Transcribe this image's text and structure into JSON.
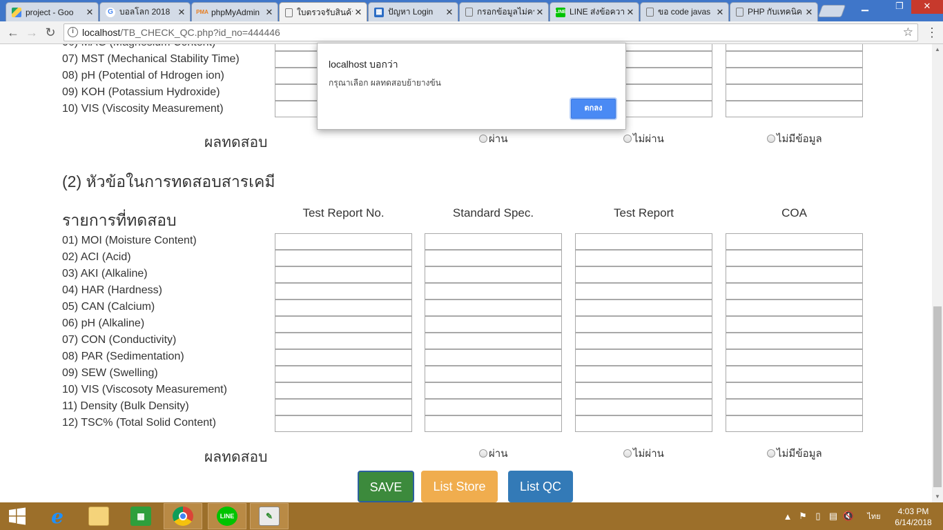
{
  "tabs": [
    {
      "title": "project - Goo",
      "icon": "google-drive-icon"
    },
    {
      "title": "บอลโลก 2018",
      "icon": "google-icon"
    },
    {
      "title": "phpMyAdmin",
      "icon": "phpmyadmin-icon"
    },
    {
      "title": "ใบตรวจรับสินค้า",
      "icon": "document-icon"
    },
    {
      "title": "ปัญหา Login",
      "icon": "site-icon"
    },
    {
      "title": "กรอกข้อมูลไม่คร",
      "icon": "document-icon"
    },
    {
      "title": "LINE ส่งข้อความ",
      "icon": "line-icon"
    },
    {
      "title": "ขอ code javas",
      "icon": "document-icon"
    },
    {
      "title": "PHP กับเทคนิค",
      "icon": "document-icon"
    }
  ],
  "address": {
    "host": "localhost",
    "path": "/TB_CHECK_QC.php?id_no=444446"
  },
  "section1_rows_partial": [
    "07) MST (Mechanical Stability Time)",
    "08) pH (Potential of Hdrogen ion)",
    "09) KOH (Potassium Hydroxide)",
    "10) VIS (Viscosity Measurement)"
  ],
  "section1_result": {
    "heading": "ผลทดสอบ",
    "options": [
      "ผ่าน",
      "ไม่ผ่าน",
      "ไม่มีข้อมูล"
    ]
  },
  "section2": {
    "heading": "(2) หัวข้อในการทดสอบสารเคมี",
    "items_heading": "รายการที่ทดสอบ",
    "columns": [
      "Test Report No.",
      "Standard Spec.",
      "Test Report",
      "COA"
    ],
    "rows": [
      "01) MOI (Moisture Content)",
      "02) ACI (Acid)",
      "03) AKI (Alkaline)",
      "04) HAR (Hardness)",
      "05) CAN (Calcium)",
      "06) pH (Alkaline)",
      "07) CON (Conductivity)",
      "08) PAR (Sedimentation)",
      "09) SEW (Swelling)",
      "10) VIS (Viscosoty Measurement)",
      "11) Density (Bulk Density)",
      "12) TSC% (Total Solid Content)"
    ],
    "result": {
      "heading": "ผลทดสอบ",
      "options": [
        "ผ่าน",
        "ไม่ผ่าน",
        "ไม่มีข้อมูล"
      ]
    }
  },
  "buttons": {
    "save": "SAVE",
    "list_store": "List Store",
    "list_qc": "List QC"
  },
  "alert": {
    "title": "localhost บอกว่า",
    "message": "กรุณาเลือก ผลทดสอบย้ายางข้น",
    "ok": "ตกลง"
  },
  "taskbar": {
    "apps": [
      "start-icon",
      "internet-explorer-icon",
      "file-explorer-icon",
      "store-icon",
      "chrome-icon",
      "line-icon",
      "notepad-plus-icon"
    ],
    "language": "ไทย",
    "time": "4:03 PM",
    "date": "6/14/2018"
  },
  "colors": {
    "save": "#3c8a3c",
    "list_store": "#f0ad4e",
    "list_qc": "#337ab7",
    "taskbar": "#9c6f2a",
    "tabstrip": "#3f76c9"
  }
}
